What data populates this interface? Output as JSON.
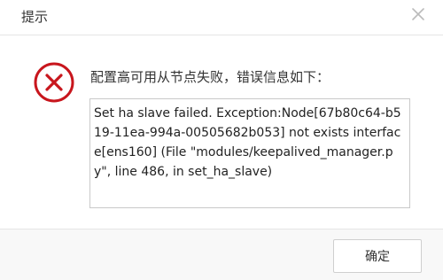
{
  "dialog": {
    "title": "提示",
    "close_icon": "close-icon",
    "error_icon": "error-circle-icon",
    "message": "配置高可用从节点失败，错误信息如下：",
    "detail": "Set ha slave failed. Exception:Node[67b80c64-b519-11ea-994a-00505682b053] not exists interface[ens160] (File \"modules/keepalived_manager.py\", line 486, in set_ha_slave)",
    "ok_label": "确定"
  },
  "colors": {
    "error_red": "#c8161d",
    "close_gray": "#bbbbbb",
    "divider": "#e5e5e5",
    "footer_bg": "#f8f8f8"
  }
}
